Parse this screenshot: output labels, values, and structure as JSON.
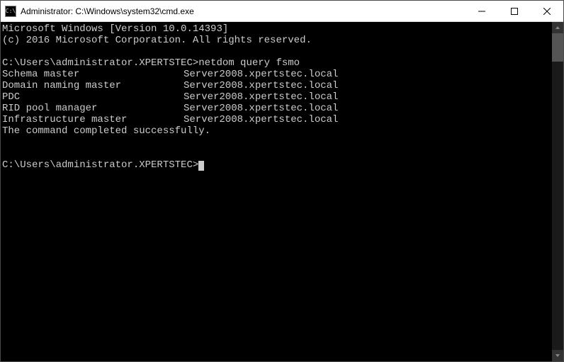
{
  "window": {
    "title": "Administrator: C:\\Windows\\system32\\cmd.exe",
    "icon_label": "C:\\"
  },
  "terminal": {
    "banner_line1": "Microsoft Windows [Version 10.0.14393]",
    "banner_line2": "(c) 2016 Microsoft Corporation. All rights reserved.",
    "prompt1": "C:\\Users\\administrator.XPERTSTEC>",
    "command1": "netdom query fsmo",
    "fsmo_roles": [
      {
        "role": "Schema master",
        "server": "Server2008.xpertstec.local"
      },
      {
        "role": "Domain naming master",
        "server": "Server2008.xpertstec.local"
      },
      {
        "role": "PDC",
        "server": "Server2008.xpertstec.local"
      },
      {
        "role": "RID pool manager",
        "server": "Server2008.xpertstec.local"
      },
      {
        "role": "Infrastructure master",
        "server": "Server2008.xpertstec.local"
      }
    ],
    "completion": "The command completed successfully.",
    "prompt2": "C:\\Users\\administrator.XPERTSTEC>"
  }
}
